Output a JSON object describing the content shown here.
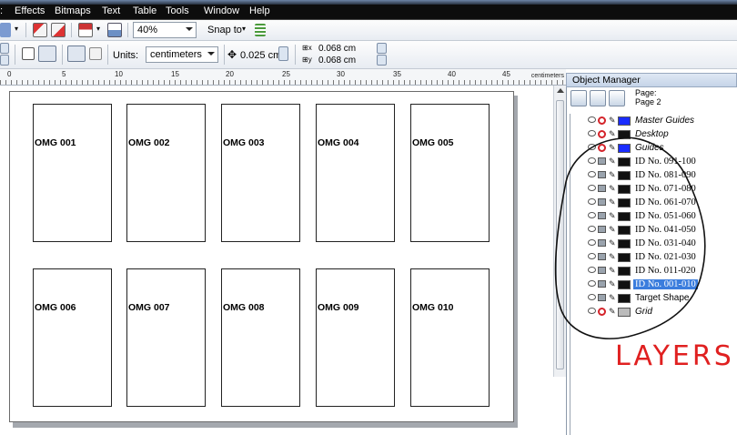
{
  "menu": [
    "Effects",
    "Bitmaps",
    "Text",
    "Table",
    "Tools",
    "Window",
    "Help"
  ],
  "toolbar": {
    "zoom_value": "40%",
    "snap_label": "Snap to"
  },
  "property_bar": {
    "units_label": "Units:",
    "units_value": "centimeters",
    "nudge_value": "0.025 cm",
    "dup_x": "0.068 cm",
    "dup_y": "0.068 cm"
  },
  "ruler": {
    "ticks": [
      "0",
      "5",
      "10",
      "15",
      "20",
      "25",
      "30",
      "35",
      "40",
      "45"
    ],
    "unit": "centimeters"
  },
  "canvas": {
    "cards": [
      "OMG 001",
      "OMG 002",
      "OMG 003",
      "OMG 004",
      "OMG 005",
      "OMG 006",
      "OMG 007",
      "OMG 008",
      "OMG 009",
      "OMG 010"
    ]
  },
  "object_manager": {
    "title": "Object Manager",
    "page_label": "Page:",
    "page_value": "Page 2",
    "layers": [
      {
        "name": "Master Guides",
        "style": "italic",
        "color": "#1a2cff",
        "printable": false
      },
      {
        "name": "Desktop",
        "style": "italic",
        "color": "#111111",
        "printable": false
      },
      {
        "name": "Guides",
        "style": "italic",
        "color": "#1a2cff",
        "printable": false
      },
      {
        "name": "ID No. 091-100",
        "style": "serif",
        "color": "#111111",
        "printable": true
      },
      {
        "name": "ID No. 081-090",
        "style": "serif",
        "color": "#111111",
        "printable": true
      },
      {
        "name": "ID No. 071-080",
        "style": "serif",
        "color": "#111111",
        "printable": true
      },
      {
        "name": "ID No. 061-070",
        "style": "serif",
        "color": "#111111",
        "printable": true
      },
      {
        "name": "ID No. 051-060",
        "style": "serif",
        "color": "#111111",
        "printable": true
      },
      {
        "name": "ID No. 041-050",
        "style": "serif",
        "color": "#111111",
        "printable": true
      },
      {
        "name": "ID No. 031-040",
        "style": "serif",
        "color": "#111111",
        "printable": true
      },
      {
        "name": "ID No. 021-030",
        "style": "serif",
        "color": "#111111",
        "printable": true
      },
      {
        "name": "ID No. 011-020",
        "style": "serif",
        "color": "#111111",
        "printable": true
      },
      {
        "name": "ID No. 001-010",
        "style": "serif",
        "color": "#111111",
        "printable": true,
        "selected": true
      },
      {
        "name": "Target Shape",
        "style": "normal",
        "color": "#111111",
        "printable": true
      },
      {
        "name": "Grid",
        "style": "italic",
        "color": "#bbbbbb",
        "printable": false
      }
    ]
  },
  "annotation": {
    "text": "LAYERS",
    "color": "#e02020"
  }
}
